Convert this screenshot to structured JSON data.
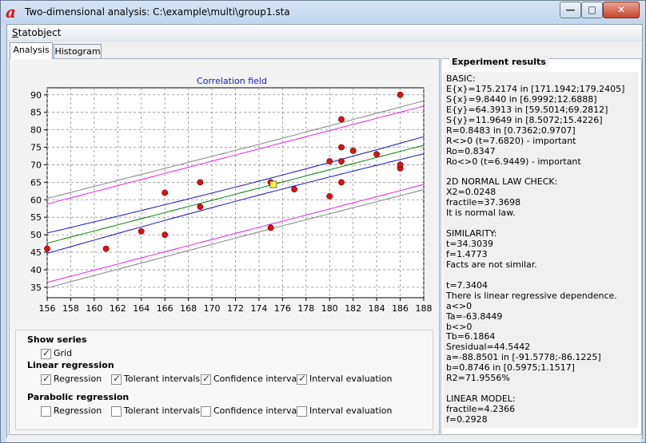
{
  "window": {
    "app_icon": "a",
    "title": "Two-dimensional analysis: C:\\example\\multi\\group1.sta",
    "minimize_glyph": "—",
    "maximize_glyph": "▢",
    "close_glyph": "✕"
  },
  "menu": {
    "statobject": "Statobject"
  },
  "tabs": [
    {
      "label": "Analysis",
      "active": true
    },
    {
      "label": "Histogram",
      "active": false
    }
  ],
  "plot": {
    "title": "Correlation field"
  },
  "chart_data": {
    "type": "scatter",
    "title": "Correlation field",
    "xlim": [
      156,
      188
    ],
    "ylim": [
      32,
      92
    ],
    "x_ticks": [
      "156",
      "158",
      "160",
      "162",
      "164",
      "166",
      "168",
      "170",
      "172",
      "174",
      "176",
      "178",
      "180",
      "182",
      "184",
      "186",
      "188"
    ],
    "y_ticks": [
      "35",
      "40",
      "45",
      "50",
      "55",
      "60",
      "65",
      "70",
      "75",
      "80",
      "85",
      "90"
    ],
    "grid": true,
    "points": [
      {
        "x": 156,
        "y": 46
      },
      {
        "x": 161,
        "y": 46
      },
      {
        "x": 164,
        "y": 51
      },
      {
        "x": 166,
        "y": 50
      },
      {
        "x": 166,
        "y": 62
      },
      {
        "x": 169,
        "y": 58
      },
      {
        "x": 169,
        "y": 65
      },
      {
        "x": 175,
        "y": 52
      },
      {
        "x": 175,
        "y": 65
      },
      {
        "x": 177,
        "y": 63
      },
      {
        "x": 180,
        "y": 61
      },
      {
        "x": 180,
        "y": 71
      },
      {
        "x": 181,
        "y": 65
      },
      {
        "x": 181,
        "y": 71
      },
      {
        "x": 181,
        "y": 75
      },
      {
        "x": 181,
        "y": 83
      },
      {
        "x": 182,
        "y": 74
      },
      {
        "x": 184,
        "y": 73
      },
      {
        "x": 186,
        "y": 69
      },
      {
        "x": 186,
        "y": 70
      },
      {
        "x": 186,
        "y": 90
      }
    ],
    "mean_point": {
      "x": 175.2174,
      "y": 64.3913
    },
    "regression": {
      "a": -88.8501,
      "b": 0.8746
    },
    "series": [
      {
        "name": "Regression",
        "color": "#008000"
      },
      {
        "name": "Tolerant intervals",
        "color": "#e020e0"
      },
      {
        "name": "Confidence intervals",
        "color": "#1010c0"
      },
      {
        "name": "Interval evaluation",
        "color": "#808080"
      }
    ]
  },
  "show_series": {
    "title": "Show series",
    "grid": {
      "label": "Grid",
      "checked": true
    },
    "linear": {
      "title": "Linear regression",
      "items": [
        {
          "label": "Regression",
          "checked": true
        },
        {
          "label": "Tolerant intervals",
          "checked": true
        },
        {
          "label": "Confidence intervals",
          "checked": true
        },
        {
          "label": "Interval evaluation",
          "checked": true
        }
      ]
    },
    "parabolic": {
      "title": "Parabolic regression",
      "items": [
        {
          "label": "Regression",
          "checked": false
        },
        {
          "label": "Tolerant intervals",
          "checked": false
        },
        {
          "label": "Confidence intervals",
          "checked": false
        },
        {
          "label": "Interval evaluation",
          "checked": false
        }
      ]
    }
  },
  "results": {
    "title": "Experiment results",
    "lines": [
      "BASIC:",
      "E{x}=175.2174 in [171.1942;179.2405]",
      "S{x}=9.8440 in [6.9992;12.6888]",
      "E{y}=64.3913 in [59.5014;69.2812]",
      "S{y}=11.9649 in [8.5072;15.4226]",
      "R=0.8483 in [0.7362;0.9707]",
      "R<>0 (t=7.6820) - important",
      "Ro=0.8347",
      "Ro<>0 (t=6.9449) - important",
      "",
      "2D NORMAL LAW CHECK:",
      "X2=0.0248",
      "fractile=37.3698",
      "It is normal law.",
      "",
      "SIMILARITY:",
      "t=34.3039",
      "f=1.4773",
      "Facts are not similar.",
      "",
      "t=7.3404",
      "There is linear regressive dependence.",
      "a<>0",
      "Ta=-63.8449",
      "b<>0",
      "Tb=6.1864",
      "Sresidual=44.5442",
      "a=-88.8501 in [-91.5778;-86.1225]",
      "b=0.8746 in [0.5975;1.1517]",
      "R2=71.9556%",
      "",
      "LINEAR MODEL:",
      "fractile=4.2366",
      "f=0.2928"
    ]
  },
  "colors": {
    "point_fill": "#e01010",
    "mean_fill": "#ffff40",
    "grid": "#8c8c8c",
    "plot_title": "#1818c8"
  }
}
